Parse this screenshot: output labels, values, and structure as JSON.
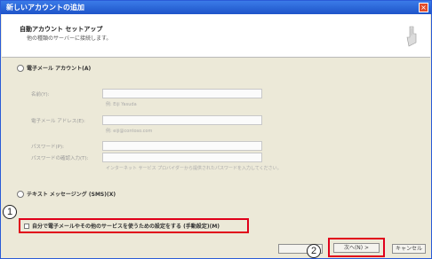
{
  "window": {
    "title": "新しいアカウントの追加",
    "close_label": "×"
  },
  "header": {
    "title": "自動アカウント セットアップ",
    "subtitle": "他の種類のサーバーに接続します。"
  },
  "options": {
    "email_account_label": "電子メール アカウント(A)",
    "fields": [
      {
        "label": "名前(Y):",
        "value": "",
        "hint": "例: Eiji Yasuda"
      },
      {
        "label": "電子メール アドレス(E):",
        "value": "",
        "hint": "例: eiji@contoso.com"
      },
      {
        "label": "パスワード(P):",
        "value": ""
      },
      {
        "label": "パスワードの確認入力(T):",
        "value": "",
        "hint": "インターネット サービス プロバイダーから提供されたパスワードを入力してください。"
      }
    ],
    "sms_label": "テキスト メッセージング (SMS)(X)",
    "manual_label": "自分で電子メールやその他のサービスを使うための設定をする (手動設定)(M)"
  },
  "badges": {
    "one": "1",
    "two": "2"
  },
  "buttons": {
    "back": "",
    "next": "次へ(N) >",
    "cancel": "キャンセル"
  },
  "colors": {
    "highlight": "#e0001a",
    "titlebar": "#1e54c9"
  }
}
